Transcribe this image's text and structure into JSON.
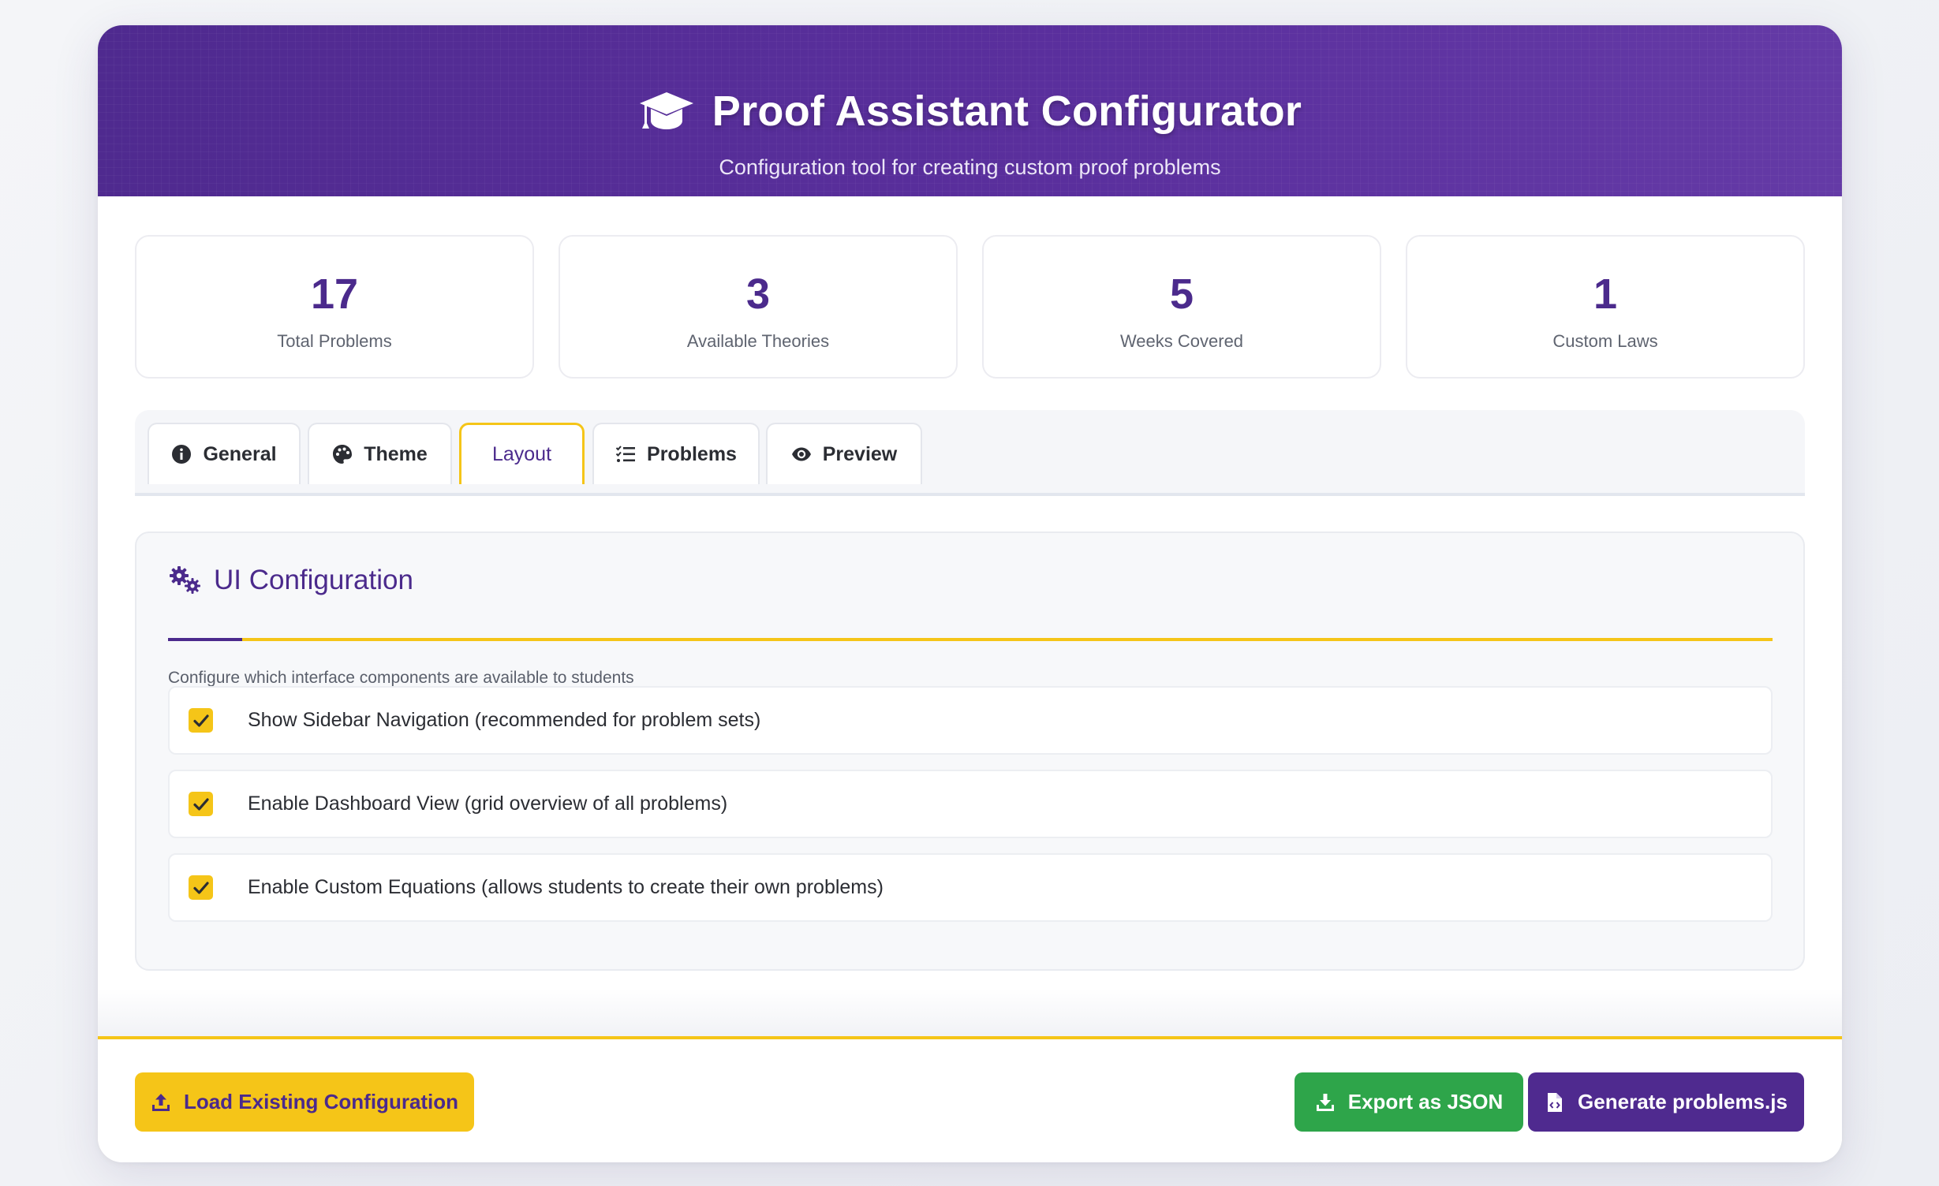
{
  "header": {
    "icon": "graduation-cap-icon",
    "title": "Proof Assistant Configurator",
    "subtitle": "Configuration tool for creating custom proof problems"
  },
  "stats": [
    {
      "value": "17",
      "label": "Total Problems"
    },
    {
      "value": "3",
      "label": "Available Theories"
    },
    {
      "value": "5",
      "label": "Weeks Covered"
    },
    {
      "value": "1",
      "label": "Custom Laws"
    }
  ],
  "tabs": [
    {
      "label": "General",
      "icon": "info-circle-icon",
      "active": false
    },
    {
      "label": "Theme",
      "icon": "palette-icon",
      "active": false
    },
    {
      "label": "Layout",
      "icon": "",
      "active": true
    },
    {
      "label": "Problems",
      "icon": "checklist-icon",
      "active": false
    },
    {
      "label": "Preview",
      "icon": "eye-icon",
      "active": false
    }
  ],
  "panel": {
    "icon": "gears-icon",
    "title": "UI Configuration",
    "description": "Configure which interface components are available to students",
    "options": [
      {
        "label": "Show Sidebar Navigation (recommended for problem sets)",
        "checked": true
      },
      {
        "label": "Enable Dashboard View (grid overview of all problems)",
        "checked": true
      },
      {
        "label": "Enable Custom Equations (allows students to create their own problems)",
        "checked": true
      }
    ]
  },
  "footer": {
    "load_label": "Load Existing Configuration",
    "export_label": "Export as JSON",
    "generate_label": "Generate problems.js"
  },
  "colors": {
    "primary": "#4b2a8c",
    "accent": "#f5c518",
    "success": "#2ea54a"
  }
}
